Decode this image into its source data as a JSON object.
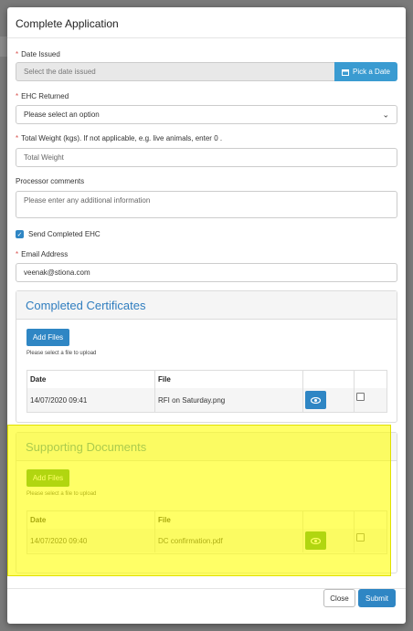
{
  "modal": {
    "title": "Complete Application"
  },
  "form": {
    "date_issued": {
      "label": "Date Issued",
      "placeholder": "Select the date issued",
      "button_label": "Pick a Date"
    },
    "ehc_returned": {
      "label": "EHC Returned",
      "selected": "Please select an option"
    },
    "total_weight": {
      "label": "Total Weight (kgs). If not applicable, e.g. live animals, enter 0 .",
      "placeholder": "Total Weight"
    },
    "processor_comments": {
      "label": "Processor comments",
      "placeholder": "Please enter any additional information"
    },
    "send_completed_ehc": {
      "label": "Send Completed EHC",
      "checked": true
    },
    "email": {
      "label": "Email Address",
      "value": "veenak@stiona.com"
    }
  },
  "completed_certificates": {
    "title": "Completed Certificates",
    "add_files_label": "Add Files",
    "hint": "Please select a file to upload",
    "columns": [
      "Date",
      "File"
    ],
    "rows": [
      {
        "date": "14/07/2020 09:41",
        "file": "RFI on Saturday.png"
      }
    ]
  },
  "supporting_documents": {
    "title": "Supporting Documents",
    "add_files_label": "Add Files",
    "hint": "Please select a file to upload",
    "columns": [
      "Date",
      "File"
    ],
    "rows": [
      {
        "date": "14/07/2020 09:40",
        "file": "DC confirmation.pdf"
      }
    ]
  },
  "footer": {
    "close_label": "Close",
    "submit_label": "Submit"
  },
  "colors": {
    "accent": "#2f86c4",
    "required": "#d9534f",
    "highlight": "#ffff00",
    "panel_title": "#2f7dbf"
  },
  "icons": [
    "calendar-icon",
    "chevron-down-icon",
    "check-icon",
    "eye-icon"
  ]
}
